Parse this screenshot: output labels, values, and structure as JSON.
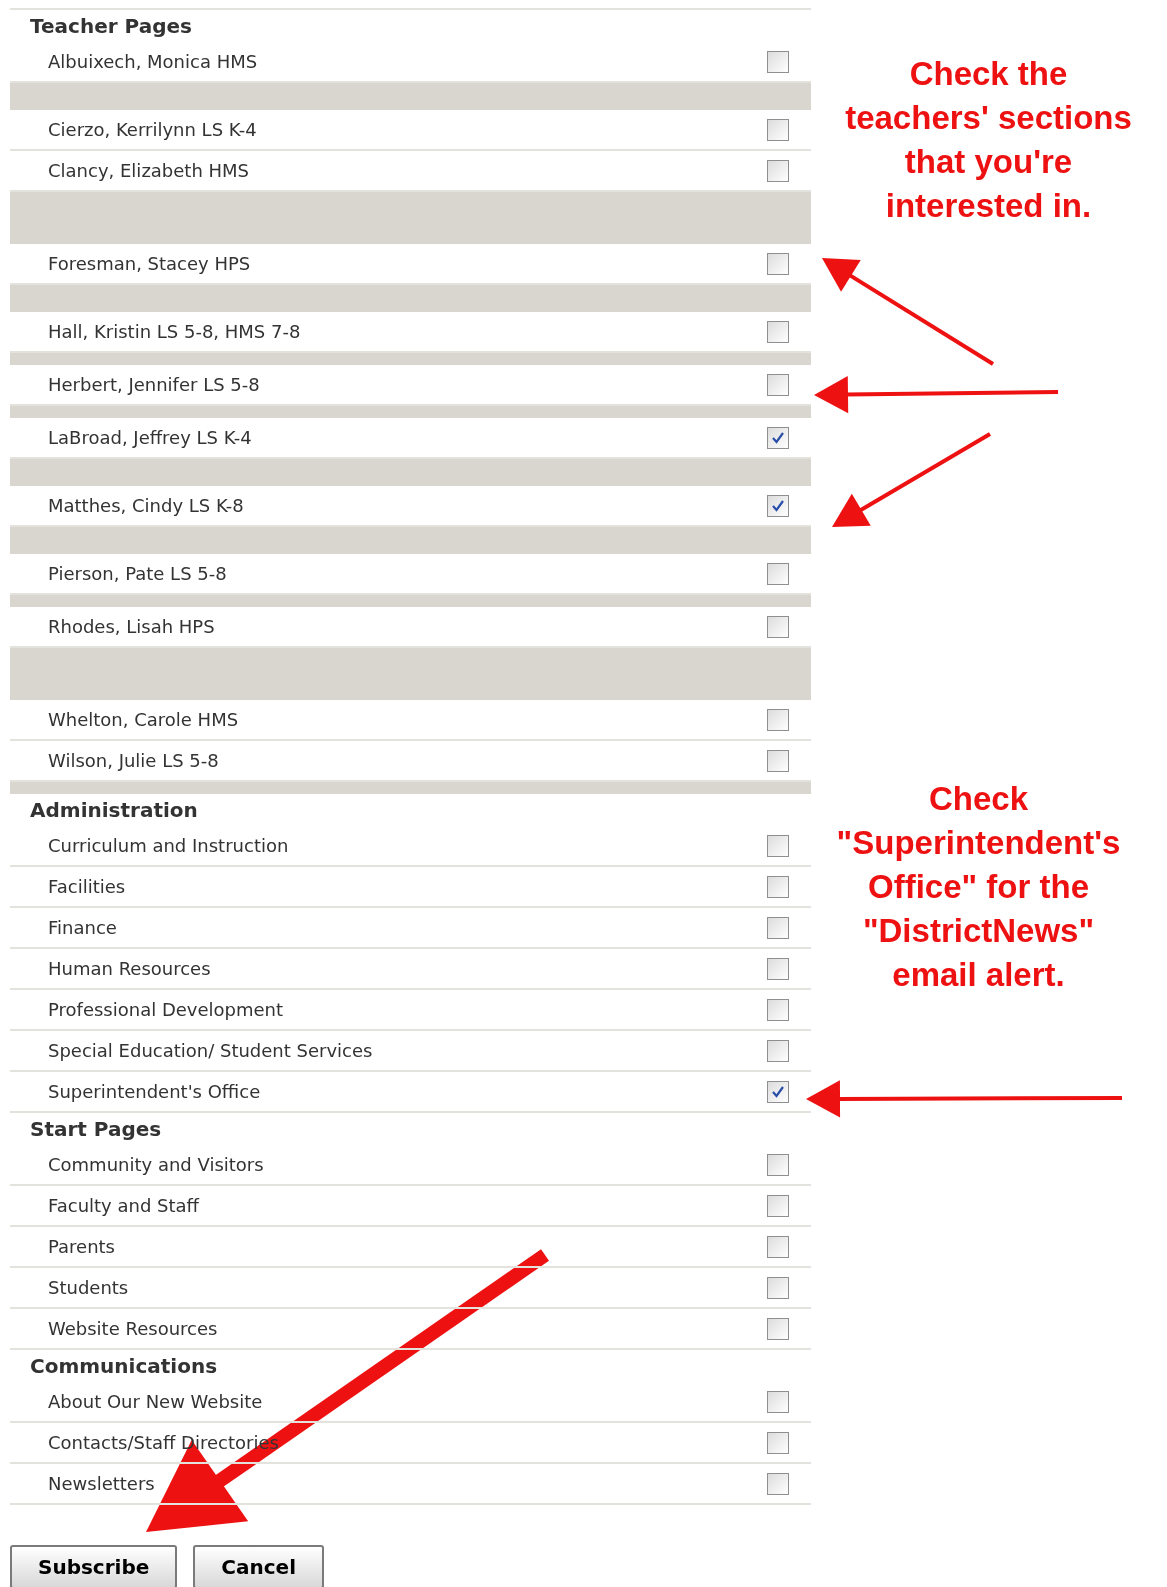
{
  "sections": [
    {
      "title": "Teacher Pages",
      "items": [
        {
          "kind": "item",
          "label": "Albuixech, Monica HMS",
          "checked": false
        },
        {
          "kind": "spacer"
        },
        {
          "kind": "item",
          "label": "Cierzo, Kerrilynn LS K-4",
          "checked": false
        },
        {
          "kind": "item",
          "label": "Clancy, Elizabeth HMS",
          "checked": false
        },
        {
          "kind": "wide"
        },
        {
          "kind": "item",
          "label": "Foresman, Stacey HPS",
          "checked": false
        },
        {
          "kind": "spacer"
        },
        {
          "kind": "item",
          "label": "Hall, Kristin LS 5-8, HMS 7-8",
          "checked": false
        },
        {
          "kind": "thin"
        },
        {
          "kind": "item",
          "label": "Herbert, Jennifer LS 5-8",
          "checked": false
        },
        {
          "kind": "thin"
        },
        {
          "kind": "item",
          "label": "LaBroad, Jeffrey LS K-4",
          "checked": true
        },
        {
          "kind": "spacer"
        },
        {
          "kind": "item",
          "label": "Matthes, Cindy LS K-8",
          "checked": true
        },
        {
          "kind": "spacer"
        },
        {
          "kind": "item",
          "label": "Pierson, Pate LS 5-8",
          "checked": false
        },
        {
          "kind": "thin"
        },
        {
          "kind": "item",
          "label": "Rhodes, Lisah HPS",
          "checked": false
        },
        {
          "kind": "wide"
        },
        {
          "kind": "item",
          "label": "Whelton, Carole HMS",
          "checked": false
        },
        {
          "kind": "item",
          "label": "Wilson, Julie LS 5-8",
          "checked": false
        },
        {
          "kind": "thin"
        }
      ]
    },
    {
      "title": "Administration",
      "items": [
        {
          "kind": "item",
          "label": "Curriculum and Instruction",
          "checked": false
        },
        {
          "kind": "item",
          "label": "Facilities",
          "checked": false
        },
        {
          "kind": "item",
          "label": "Finance",
          "checked": false
        },
        {
          "kind": "item",
          "label": "Human Resources",
          "checked": false
        },
        {
          "kind": "item",
          "label": "Professional Development",
          "checked": false
        },
        {
          "kind": "item",
          "label": "Special Education/ Student Services",
          "checked": false
        },
        {
          "kind": "item",
          "label": "Superintendent's Office",
          "checked": true
        }
      ]
    },
    {
      "title": "Start Pages",
      "items": [
        {
          "kind": "item",
          "label": "Community and Visitors",
          "checked": false
        },
        {
          "kind": "item",
          "label": "Faculty and Staff",
          "checked": false
        },
        {
          "kind": "item",
          "label": "Parents",
          "checked": false
        },
        {
          "kind": "item",
          "label": "Students",
          "checked": false
        },
        {
          "kind": "item",
          "label": "Website Resources",
          "checked": false
        }
      ]
    },
    {
      "title": "Communications",
      "items": [
        {
          "kind": "item",
          "label": "About Our New Website",
          "checked": false
        },
        {
          "kind": "item",
          "label": "Contacts/Staff Directories",
          "checked": false
        },
        {
          "kind": "item",
          "label": "Newsletters",
          "checked": false
        }
      ]
    }
  ],
  "buttons": [
    "Subscribe",
    "Cancel"
  ],
  "annotations": [
    {
      "lines": [
        "Check the",
        "teachers' sections",
        "that you're",
        "interested in."
      ]
    },
    {
      "lines": [
        "Check",
        "\"Superintendent's",
        "Office\" for the",
        "\"DistrictNews\"",
        "email alert."
      ]
    }
  ]
}
